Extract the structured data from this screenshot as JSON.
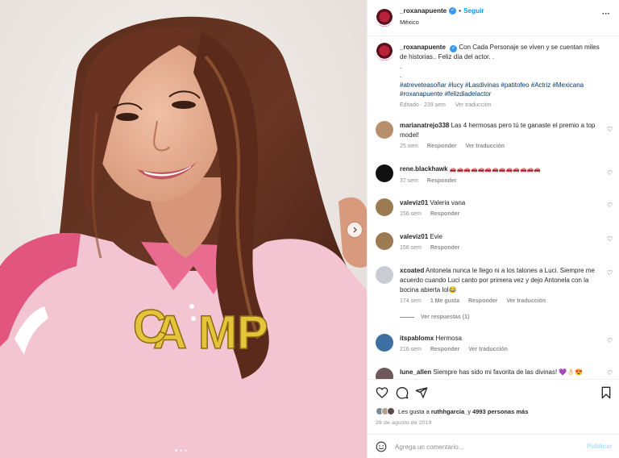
{
  "header": {
    "username": "_roxanapuente",
    "follow_label": "Seguir",
    "separator": "•",
    "location": "México",
    "more_icon": "more-horizontal-icon"
  },
  "caption": {
    "username": "_roxanapuente",
    "text": "Con Cada Personaje se viven y se cuentan miles de historias.. Feliz día del actor. .",
    "dots": ".",
    "dots2": ".",
    "hashtags": "#atreveteasoñar #lucy #Lasdivinas #patitofeo #Actriz #Mexicana #roxanapuente #felizdiadelactor",
    "edited_label": "Editado · 239 sem",
    "translate_label": "Ver traducción"
  },
  "comments": [
    {
      "username": "marianatrejo338",
      "text": "Las 4 hermosas pero tú te ganaste el premio a top model!",
      "time": "25 sem",
      "reply": "Responder",
      "translate": "Ver traducción"
    },
    {
      "username": "rene.blackhawk",
      "text": "🚗🚗🚗🚗🚗🚗🚗🚗🚗🚗🚗🚗🚗",
      "time": "37 sem",
      "reply": "Responder"
    },
    {
      "username": "valeviz01",
      "text": "Valeria vana",
      "time": "156 sem",
      "reply": "Responder"
    },
    {
      "username": "valeviz01",
      "text": "Evie",
      "time": "156 sem",
      "reply": "Responder"
    },
    {
      "username": "xcoated",
      "text": "Antonela nunca le llego ni a los talones a Luci. Siempre me acuerdo cuando Luci canto por primera vez y dejo Antonela con la bocina abierta lol😂",
      "time": "174 sem",
      "likes": "1 Me gusta",
      "reply": "Responder",
      "translate": "Ver traducción"
    },
    {
      "username": "itspablomx",
      "text": "Hermosa",
      "time": "216 sem",
      "reply": "Responder",
      "translate": "Ver traducción"
    },
    {
      "username": "lune_allen",
      "text": "Siempre has sido mi favorita de las divinas! 💜👌🏻😍"
    }
  ],
  "view_replies_label": "Ver respuestas (1)",
  "likes": {
    "prefix": "Les gusta a",
    "user": "ruthhgarcia_",
    "middle": "y",
    "count": "4993 personas más"
  },
  "date": "26 de agosto de 2019",
  "add_comment": {
    "placeholder": "Agrega un comentario...",
    "publish_label": "Publicar"
  },
  "colors": {
    "accent": "#0095f6",
    "verified": "#3897f0",
    "muted": "#8e8e8e",
    "hashtag": "#00376b"
  }
}
